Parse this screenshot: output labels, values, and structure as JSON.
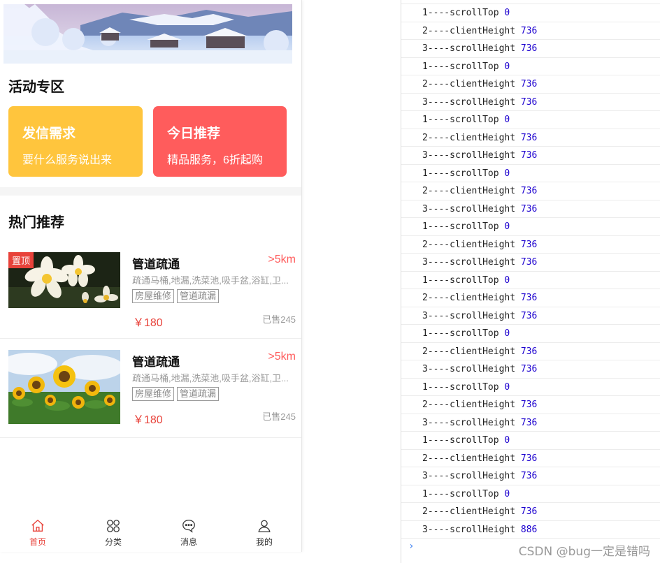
{
  "section_activity": {
    "title": "活动专区"
  },
  "activity_cards": [
    {
      "title": "发信需求",
      "subtitle": "要什么服务说出来",
      "color": "#ffc53d"
    },
    {
      "title": "今日推荐",
      "subtitle": "精品服务，6折起购",
      "color": "#ff5c5c"
    }
  ],
  "section_hot": {
    "title": "热门推荐"
  },
  "products": [
    {
      "badge": "置顶",
      "title": "管道疏通",
      "distance": ">5km",
      "desc": "疏通马桶,地漏,洗菜池,吸手盆,浴缸,卫...",
      "tags": [
        "房屋维修",
        "管道疏漏"
      ],
      "price": "￥180",
      "sold": "已售245"
    },
    {
      "title": "管道疏通",
      "distance": ">5km",
      "desc": "疏通马桶,地漏,洗菜池,吸手盆,浴缸,卫...",
      "tags": [
        "房屋维修",
        "管道疏漏"
      ],
      "price": "￥180",
      "sold": "已售245"
    }
  ],
  "tabbar": [
    {
      "label": "首页",
      "icon": "home-icon",
      "active": true
    },
    {
      "label": "分类",
      "icon": "category-grid-icon",
      "active": false
    },
    {
      "label": "消息",
      "icon": "message-bubble-icon",
      "active": false
    },
    {
      "label": "我的",
      "icon": "user-profile-icon",
      "active": false
    }
  ],
  "console": {
    "lines": [
      {
        "label": "1----scrollTop",
        "value": "0"
      },
      {
        "label": "2----clientHeight",
        "value": "736"
      },
      {
        "label": "3----scrollHeight",
        "value": "736"
      },
      {
        "label": "1----scrollTop",
        "value": "0"
      },
      {
        "label": "2----clientHeight",
        "value": "736"
      },
      {
        "label": "3----scrollHeight",
        "value": "736"
      },
      {
        "label": "1----scrollTop",
        "value": "0"
      },
      {
        "label": "2----clientHeight",
        "value": "736"
      },
      {
        "label": "3----scrollHeight",
        "value": "736"
      },
      {
        "label": "1----scrollTop",
        "value": "0"
      },
      {
        "label": "2----clientHeight",
        "value": "736"
      },
      {
        "label": "3----scrollHeight",
        "value": "736"
      },
      {
        "label": "1----scrollTop",
        "value": "0"
      },
      {
        "label": "2----clientHeight",
        "value": "736"
      },
      {
        "label": "3----scrollHeight",
        "value": "736"
      },
      {
        "label": "1----scrollTop",
        "value": "0"
      },
      {
        "label": "2----clientHeight",
        "value": "736"
      },
      {
        "label": "3----scrollHeight",
        "value": "736"
      },
      {
        "label": "1----scrollTop",
        "value": "0"
      },
      {
        "label": "2----clientHeight",
        "value": "736"
      },
      {
        "label": "3----scrollHeight",
        "value": "736"
      },
      {
        "label": "1----scrollTop",
        "value": "0"
      },
      {
        "label": "2----clientHeight",
        "value": "736"
      },
      {
        "label": "3----scrollHeight",
        "value": "736"
      },
      {
        "label": "1----scrollTop",
        "value": "0"
      },
      {
        "label": "2----clientHeight",
        "value": "736"
      },
      {
        "label": "3----scrollHeight",
        "value": "736"
      },
      {
        "label": "1----scrollTop",
        "value": "0"
      },
      {
        "label": "2----clientHeight",
        "value": "736"
      },
      {
        "label": "3----scrollHeight",
        "value": "886"
      }
    ],
    "prompt": "›",
    "watermark": "CSDN @bug一定是错吗"
  },
  "colors": {
    "accent": "#e8423a",
    "console_number": "#1c00cf",
    "console_prompt": "#367cf1"
  }
}
